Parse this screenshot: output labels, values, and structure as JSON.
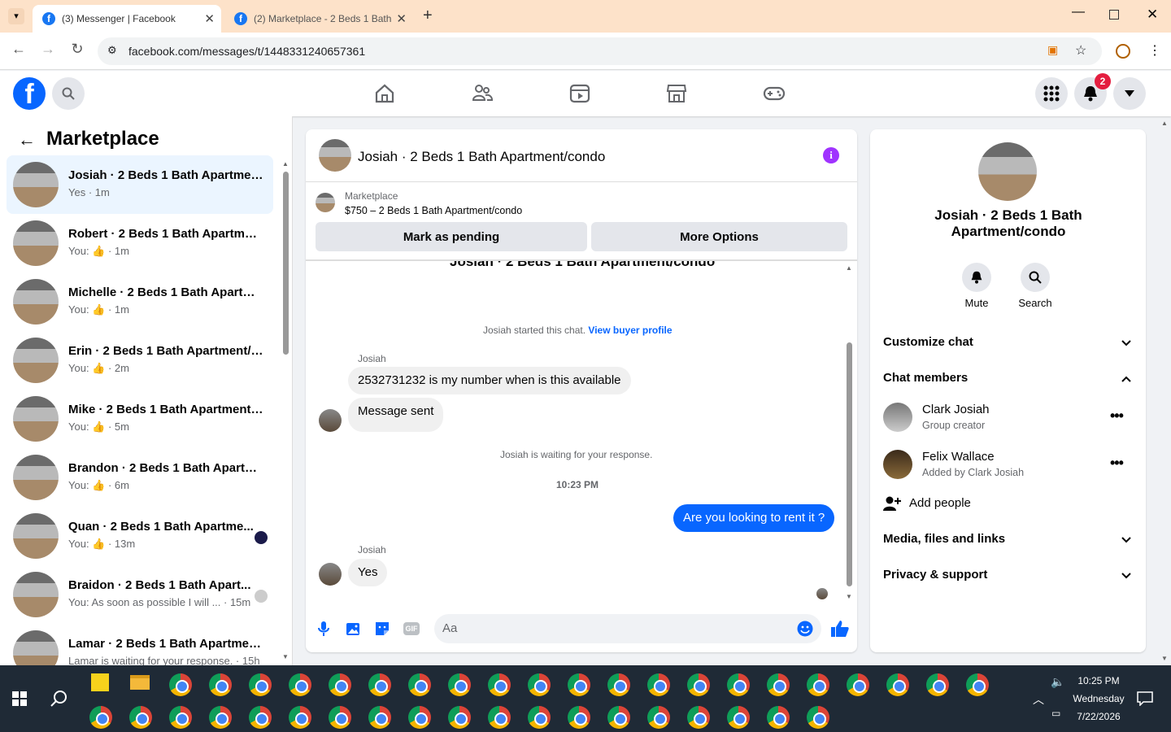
{
  "browser": {
    "tabs": [
      {
        "title": "(3) Messenger | Facebook"
      },
      {
        "title": "(2) Marketplace - 2 Beds 1 Bath"
      }
    ],
    "url": "facebook.com/messages/t/1448331240657361"
  },
  "header": {
    "notification_count": "2"
  },
  "left": {
    "title": "Marketplace",
    "conversations": [
      {
        "name": "Josiah · 2 Beds 1 Bath Apartmen...",
        "sub": "Yes · 1m"
      },
      {
        "name": "Robert · 2 Beds 1 Bath Apartmen...",
        "sub": "You: 👍 · 1m"
      },
      {
        "name": "Michelle · 2 Beds 1 Bath Apartm...",
        "sub": "You: 👍 · 1m"
      },
      {
        "name": "Erin · 2 Beds 1 Bath Apartment/c...",
        "sub": "You: 👍 · 2m"
      },
      {
        "name": "Mike · 2 Beds 1 Bath Apartment/...",
        "sub": "You: 👍 · 5m"
      },
      {
        "name": "Brandon · 2 Beds 1 Bath Apartm...",
        "sub": "You: 👍 · 6m"
      },
      {
        "name": "Quan · 2 Beds 1 Bath Apartme...",
        "sub": "You: 👍 · 13m"
      },
      {
        "name": "Braidon · 2 Beds 1 Bath Apart...",
        "sub": "You: As soon as possible I will ... · 15m"
      },
      {
        "name": "Lamar · 2 Beds 1 Bath Apartmen...",
        "sub": "Lamar is waiting for your response. · 15h"
      }
    ]
  },
  "chat": {
    "title": "Josiah · 2 Beds 1 Bath Apartment/condo",
    "listing_label": "Marketplace",
    "listing": "$750 – 2 Beds 1 Bath Apartment/condo",
    "mark_pending": "Mark as pending",
    "more_options": "More Options",
    "cut_title": "Josiah · 2 Beds 1 Bath Apartment/condo",
    "started": "Josiah started this chat.",
    "view_profile": "View buyer profile",
    "sender": "Josiah",
    "msg1": "2532731232 is my number when is this available",
    "msg2": "Message sent",
    "waiting": "Josiah is waiting for your response.",
    "time": "10:23 PM",
    "my_msg": "Are you looking to rent it ?",
    "sender2": "Josiah",
    "msg3": "Yes",
    "input_placeholder": "Aa"
  },
  "info": {
    "name": "Josiah · 2 Beds 1 Bath Apartment/condo",
    "mute": "Mute",
    "search": "Search",
    "customize": "Customize chat",
    "members_title": "Chat members",
    "members": [
      {
        "name": "Clark Josiah",
        "role": "Group creator"
      },
      {
        "name": "Felix Wallace",
        "role": "Added by Clark Josiah"
      }
    ],
    "add_people": "Add people",
    "media": "Media, files and links",
    "privacy": "Privacy & support"
  },
  "taskbar": {
    "time": "10:25 PM",
    "day": "Wednesday",
    "date": "7/22/2026"
  },
  "colors": {
    "brand": "#0866ff",
    "accent_purple": "#a033ff",
    "badge": "#e41e3f"
  }
}
